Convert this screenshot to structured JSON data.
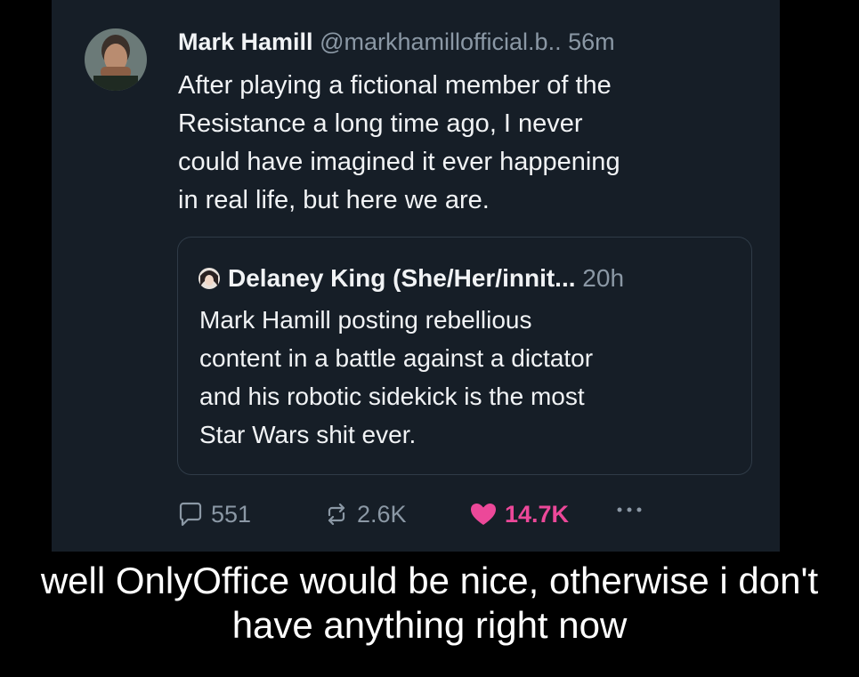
{
  "post": {
    "author_name": "Mark Hamill",
    "handle": "@markhamillofficial.b..",
    "time": "56m",
    "text": "After playing a fictional member of the\nResistance a long time ago, I never\ncould have imagined it ever happening\nin real life, but here we are.",
    "quote": {
      "author_name": "Delaney King (She/Her/innit...",
      "time": "20h",
      "text": "Mark Hamill posting rebellious\ncontent in a battle against a dictator\nand his robotic sidekick is the most\nStar Wars shit ever."
    },
    "actions": {
      "replies": "551",
      "reposts": "2.6K",
      "likes": "14.7K"
    }
  },
  "caption": "well OnlyOffice would be nice, otherwise i don't\nhave anything right now",
  "colors": {
    "background": "#000000",
    "card": "#161e27",
    "text": "#f1f3f5",
    "muted": "#8b98a5",
    "like": "#ec4899",
    "quote_border": "#2f3b47"
  },
  "icons": {
    "reply": "speech-bubble-icon",
    "repost": "repost-arrows-icon",
    "like": "heart-icon",
    "more": "ellipsis-icon"
  }
}
